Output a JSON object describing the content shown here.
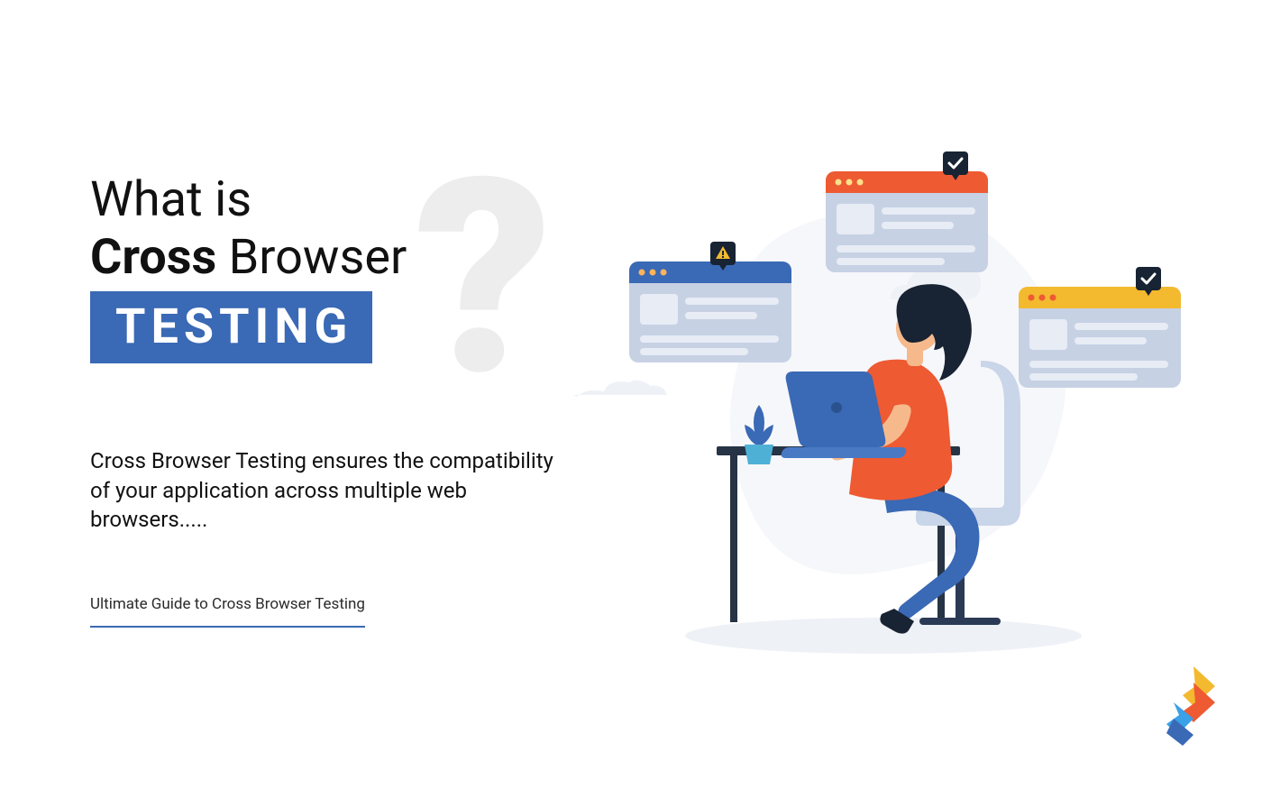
{
  "title": {
    "line1": "What is",
    "bold": "Cross",
    "line2_rest": " Browser",
    "boxed": "TESTING"
  },
  "desc": "Cross Browser Testing ensures the compatibility of your application across multiple web browsers.....",
  "subtitle": "Ultimate Guide to Cross Browser Testing",
  "illustration": {
    "windows": [
      {
        "header": "#3a69b5",
        "icon": "warning"
      },
      {
        "header": "#ee5a32",
        "icon": "check"
      },
      {
        "header": "#f3b92f",
        "icon": "check"
      }
    ]
  },
  "colors": {
    "accent": "#3a69b5",
    "orange": "#ee5a32",
    "yellow": "#f3b92f",
    "black": "#182333",
    "skin": "#f6b98c",
    "hair": "#182333",
    "shirt": "#ee5a32",
    "pants": "#3a69b5",
    "laptop": "#3a69b5",
    "desk": "#263445",
    "plant": "#3a69b5",
    "pot": "#4fb0d6",
    "chair": "#c9d5e8",
    "shadow": "#eef1f6",
    "cloud": "#eef1f6"
  }
}
